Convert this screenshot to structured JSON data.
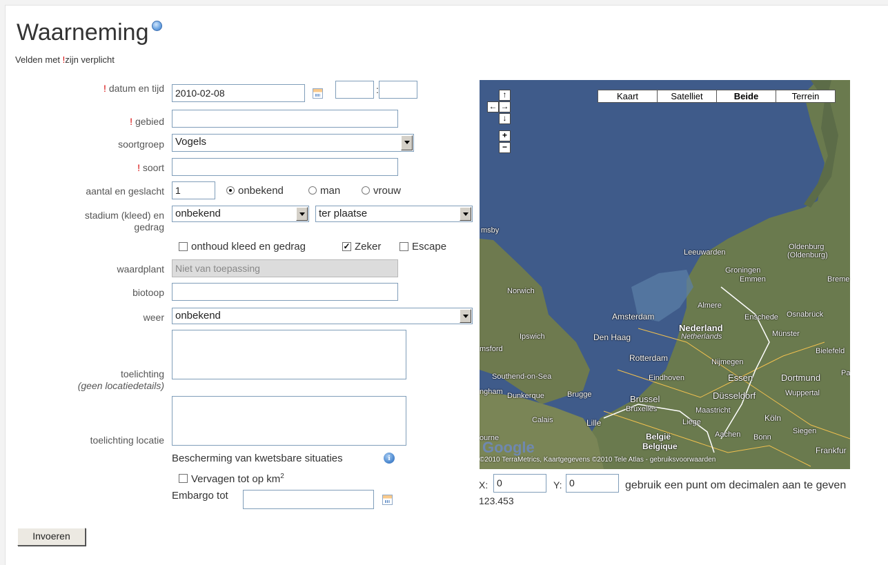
{
  "page": {
    "title": "Waarneming",
    "required_note_prefix": "Velden met",
    "required_mark": "!",
    "required_note_suffix": "zijn verplicht"
  },
  "form": {
    "date_time": {
      "label": "datum en tijd",
      "date_value": "2010-02-08",
      "hour_value": "",
      "minute_value": "",
      "separator": ":"
    },
    "area": {
      "label": "gebied",
      "value": ""
    },
    "species_group": {
      "label": "soortgroep",
      "selected": "Vogels"
    },
    "species": {
      "label": "soort",
      "value": ""
    },
    "count_sex": {
      "label": "aantal en geslacht",
      "count_value": "1",
      "options": [
        "onbekend",
        "man",
        "vrouw"
      ],
      "selected": "onbekend"
    },
    "stage_behavior": {
      "label_line1": "stadium (kleed) en",
      "label_line2": "gedrag",
      "stage_selected": "onbekend",
      "behavior_selected": "ter plaatse"
    },
    "checkboxes": [
      {
        "label": "onthoud kleed en gedrag",
        "checked": false
      },
      {
        "label": "Zeker",
        "checked": true
      },
      {
        "label": "Escape",
        "checked": false
      }
    ],
    "host_plant": {
      "label": "waardplant",
      "placeholder": "Niet van toepassing"
    },
    "biotope": {
      "label": "biotoop",
      "value": ""
    },
    "weather": {
      "label": "weer",
      "selected": "onbekend"
    },
    "notes": {
      "label": "toelichting",
      "sublabel": "(geen locatiedetails)"
    },
    "location_notes": {
      "label": "toelichting locatie"
    },
    "protection": {
      "heading": "Bescherming van kwetsbare situaties",
      "blur_label": "Vervagen tot op km",
      "blur_superscript": "2",
      "embargo_label": "Embargo tot",
      "embargo_value": ""
    },
    "submit_label": "Invoeren"
  },
  "map": {
    "type_buttons": [
      "Kaart",
      "Satelliet",
      "Beide",
      "Terrein"
    ],
    "active_type": "Beide",
    "nav": {
      "up": "↑",
      "left": "←",
      "right": "→",
      "down": "↓",
      "zoom_in": "+",
      "zoom_out": "−"
    },
    "labels": [
      "msby",
      "Leeuwarden",
      "Oldenburg",
      "(Oldenburg)",
      "Groningen",
      "Emmen",
      "Breme",
      "Norwich",
      "Almere",
      "Amsterdam",
      "Enschede",
      "Osnabrück",
      "Ipswich",
      "Den Haag",
      "Nederland",
      "Netherlands",
      "Münster",
      "msford",
      "Rotterdam",
      "Nijmegen",
      "Bielefeld",
      "Southend-on-Sea",
      "Eindhoven",
      "Essen",
      "Dortmund",
      "Pa",
      "ngham",
      "Dunkerque",
      "Brugge",
      "Brussel",
      "Düsseldorf",
      "Wuppertal",
      "Bruxelles",
      "Maastricht",
      "Calais",
      "Lille",
      "Liège",
      "Köln",
      "België",
      "Aachen",
      "Siegen",
      "Belgique",
      "Bonn",
      "ourne",
      "Frankfur"
    ],
    "google_logo": "Google",
    "copyright": "©2010 TerraMetrics, Kaartgegevens ©2010 Tele Atlas - gebruiksvoorwaarden"
  },
  "coords": {
    "x_label": "X:",
    "x_value": "0",
    "y_label": "Y:",
    "y_value": "0",
    "hint": "gebruik een punt om decimalen aan te geven",
    "example": "123.453"
  }
}
